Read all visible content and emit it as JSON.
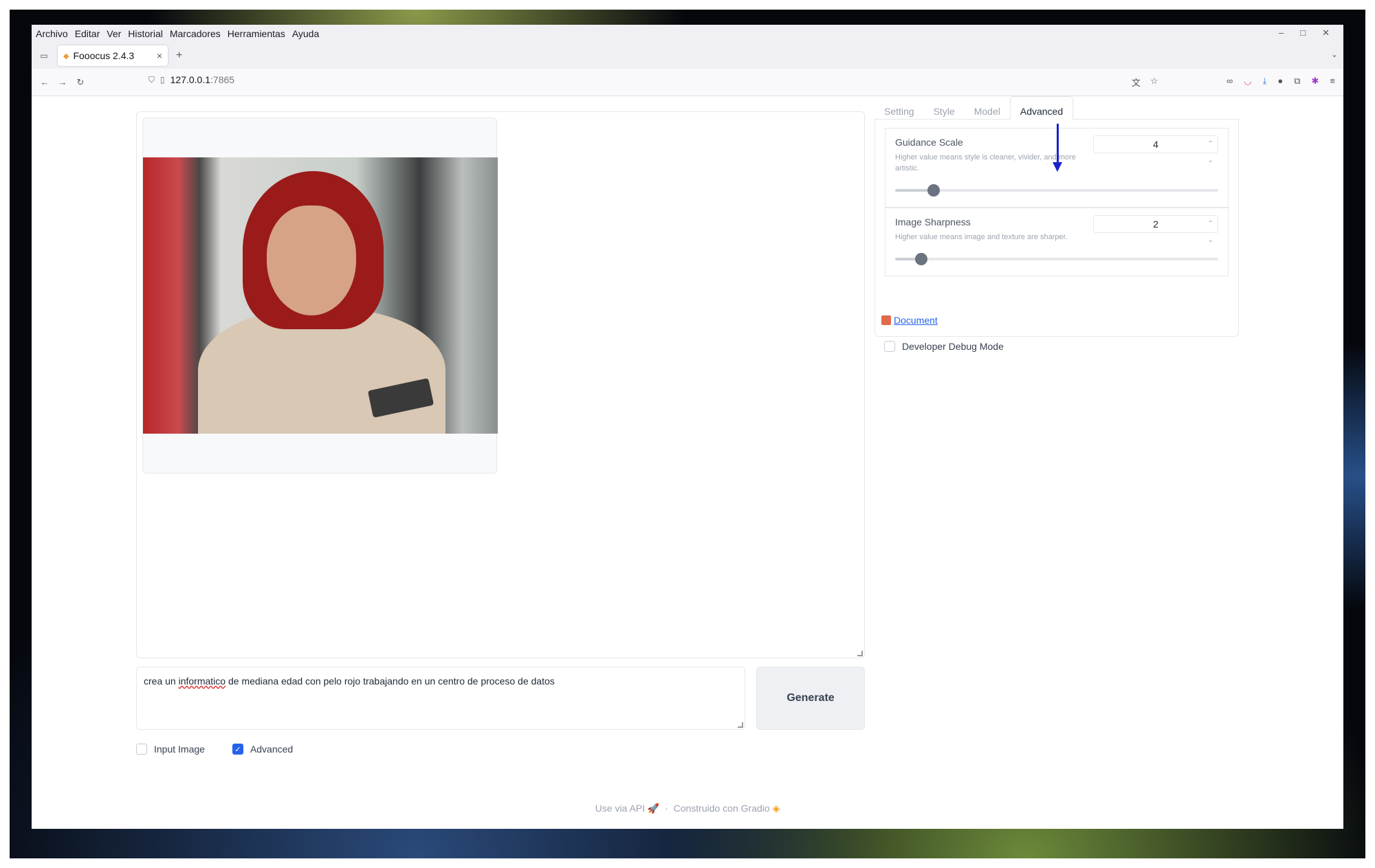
{
  "browser": {
    "menu": [
      "Archivo",
      "Editar",
      "Ver",
      "Historial",
      "Marcadores",
      "Herramientas",
      "Ayuda"
    ],
    "tab_title": "Fooocus 2.4.3",
    "url_host": "127.0.0.1",
    "url_port": ":7865"
  },
  "tabs": [
    "Setting",
    "Style",
    "Model",
    "Advanced"
  ],
  "active_tab": "Advanced",
  "advanced": {
    "guidance": {
      "label": "Guidance Scale",
      "info": "Higher value means style is cleaner, vivider, and more artistic.",
      "value": "4",
      "slider_fraction": 0.12
    },
    "sharpness": {
      "label": "Image Sharpness",
      "info": "Higher value means image and texture are sharper.",
      "value": "2",
      "slider_fraction": 0.08
    },
    "document_link": "Document",
    "debug_label": "Developer Debug Mode"
  },
  "prompt": {
    "before": "crea un ",
    "misspelled": "informatico",
    "after": " de mediana edad con pelo rojo trabajando en un centro de proceso de datos"
  },
  "generate_label": "Generate",
  "checkboxes": {
    "input_image": {
      "label": "Input Image",
      "checked": false
    },
    "advanced": {
      "label": "Advanced",
      "checked": true
    }
  },
  "footer": {
    "api": "Use via API",
    "sep": "·",
    "built": "Construido con Gradio"
  },
  "colors": {
    "accent": "#2563eb",
    "annotation_arrow": "#1a22c8"
  }
}
